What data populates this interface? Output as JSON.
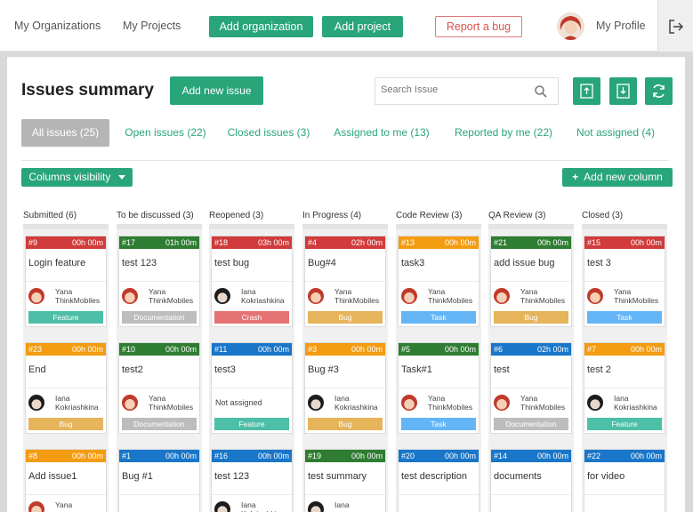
{
  "nav": {
    "my_organizations": "My Organizations",
    "my_projects": "My Projects",
    "add_organization": "Add organization",
    "add_project": "Add project",
    "report_bug": "Report a bug",
    "my_profile": "My Profile",
    "logout_icon": "logout-icon"
  },
  "header": {
    "title": "Issues summary",
    "add_new_issue": "Add new issue",
    "search_placeholder": "Search Issue",
    "icons": [
      "upload-icon",
      "download-icon",
      "refresh-icon"
    ]
  },
  "filters": [
    "All issues (25)",
    "Open issues (22)",
    "Closed issues (3)",
    "Assigned to me (13)",
    "Reported by me (22)",
    "Not assigned (4)"
  ],
  "columns_visibility": "Columns visibility",
  "add_new_column": "Add new column",
  "colors": {
    "accent": "#29a57a",
    "red": "#d13b3b",
    "green_dark": "#2e7d32",
    "orange": "#f39c12",
    "blue": "#1976c9",
    "tag_feature": "#4cbfa6",
    "tag_documentation": "#bdbdbd",
    "tag_crash": "#e57373",
    "tag_bug": "#e6b45a",
    "tag_task": "#64b5f6"
  },
  "columns": [
    {
      "name": "Submitted (6)",
      "cards": [
        {
          "id": "#9",
          "time": "00h 00m",
          "color": "red",
          "title": "Login feature",
          "user1": "Yana",
          "user2": "ThinkMobiles",
          "avatar": "red",
          "tag": "Feature",
          "tag_color": "tag_feature"
        },
        {
          "id": "#23",
          "time": "00h 00m",
          "color": "orange",
          "title": "End",
          "user1": "Iana",
          "user2": "Kokriashkina",
          "avatar": "dark",
          "tag": "Bug",
          "tag_color": "tag_bug"
        },
        {
          "id": "#8",
          "time": "00h 00m",
          "color": "orange",
          "title": "Add issue1",
          "user1": "Yana",
          "user2": "",
          "avatar": "red",
          "tag": "",
          "tag_color": ""
        }
      ]
    },
    {
      "name": "To be discussed (3)",
      "cards": [
        {
          "id": "#17",
          "time": "01h 00m",
          "color": "green_dark",
          "title": "test 123",
          "user1": "Yana",
          "user2": "ThinkMobiles",
          "avatar": "red",
          "tag": "Documentation",
          "tag_color": "tag_documentation"
        },
        {
          "id": "#10",
          "time": "00h 00m",
          "color": "green_dark",
          "title": "test2",
          "user1": "Yana",
          "user2": "ThinkMobiles",
          "avatar": "red",
          "tag": "Documentation",
          "tag_color": "tag_documentation"
        },
        {
          "id": "#1",
          "time": "00h 00m",
          "color": "blue",
          "title": "Bug #1",
          "user1": "",
          "user2": "",
          "avatar": "",
          "tag": "",
          "tag_color": ""
        }
      ]
    },
    {
      "name": "Reopened (3)",
      "cards": [
        {
          "id": "#18",
          "time": "03h 00m",
          "color": "red",
          "title": "test bug",
          "user1": "Iana",
          "user2": "Kokriashkina",
          "avatar": "dark",
          "tag": "Crash",
          "tag_color": "tag_crash"
        },
        {
          "id": "#11",
          "time": "00h 00m",
          "color": "blue",
          "title": "test3",
          "user1": "",
          "user2": "",
          "avatar": "",
          "not_assigned": "Not assigned",
          "tag": "Feature",
          "tag_color": "tag_feature"
        },
        {
          "id": "#16",
          "time": "00h 00m",
          "color": "blue",
          "title": "test 123",
          "user1": "Iana",
          "user2": "Kokriashkina",
          "avatar": "dark",
          "tag": "",
          "tag_color": ""
        }
      ]
    },
    {
      "name": "In Progress (4)",
      "cards": [
        {
          "id": "#4",
          "time": "02h 00m",
          "color": "red",
          "title": "Bug#4",
          "user1": "Yana",
          "user2": "ThinkMobiles",
          "avatar": "red",
          "tag": "Bug",
          "tag_color": "tag_bug"
        },
        {
          "id": "#3",
          "time": "00h 00m",
          "color": "orange",
          "title": "Bug #3",
          "user1": "Iana",
          "user2": "Kokriashkina",
          "avatar": "dark",
          "tag": "Bug",
          "tag_color": "tag_bug"
        },
        {
          "id": "#19",
          "time": "00h 00m",
          "color": "green_dark",
          "title": "test summary",
          "user1": "Iana",
          "user2": "",
          "avatar": "dark",
          "tag": "",
          "tag_color": ""
        }
      ]
    },
    {
      "name": "Code Review (3)",
      "cards": [
        {
          "id": "#13",
          "time": "00h 00m",
          "color": "orange",
          "title": "task3",
          "user1": "Yana",
          "user2": "ThinkMobiles",
          "avatar": "red",
          "tag": "Task",
          "tag_color": "tag_task"
        },
        {
          "id": "#5",
          "time": "00h 00m",
          "color": "green_dark",
          "title": "Task#1",
          "user1": "Yana",
          "user2": "ThinkMobiles",
          "avatar": "red",
          "tag": "Task",
          "tag_color": "tag_task"
        },
        {
          "id": "#20",
          "time": "00h 00m",
          "color": "blue",
          "title": "test description",
          "user1": "",
          "user2": "",
          "avatar": "",
          "tag": "",
          "tag_color": ""
        }
      ]
    },
    {
      "name": "QA Review (3)",
      "cards": [
        {
          "id": "#21",
          "time": "00h 00m",
          "color": "green_dark",
          "title": "add issue bug",
          "user1": "Yana",
          "user2": "ThinkMobiles",
          "avatar": "red",
          "tag": "Bug",
          "tag_color": "tag_bug"
        },
        {
          "id": "#6",
          "time": "02h 00m",
          "color": "blue",
          "title": "test",
          "user1": "Yana",
          "user2": "ThinkMobiles",
          "avatar": "red",
          "tag": "Documentation",
          "tag_color": "tag_documentation"
        },
        {
          "id": "#14",
          "time": "00h 00m",
          "color": "blue",
          "title": "documents",
          "user1": "",
          "user2": "",
          "avatar": "",
          "tag": "",
          "tag_color": ""
        }
      ]
    },
    {
      "name": "Closed (3)",
      "cards": [
        {
          "id": "#15",
          "time": "00h 00m",
          "color": "red",
          "title": "test 3",
          "user1": "Yana",
          "user2": "ThinkMobiles",
          "avatar": "red",
          "tag": "Task",
          "tag_color": "tag_task"
        },
        {
          "id": "#7",
          "time": "00h 00m",
          "color": "orange",
          "title": "test 2",
          "user1": "Iana",
          "user2": "Kokriashkina",
          "avatar": "dark",
          "tag": "Feature",
          "tag_color": "tag_feature"
        },
        {
          "id": "#22",
          "time": "00h 00m",
          "color": "blue",
          "title": "for video",
          "user1": "",
          "user2": "",
          "avatar": "",
          "tag": "",
          "tag_color": ""
        }
      ]
    }
  ]
}
